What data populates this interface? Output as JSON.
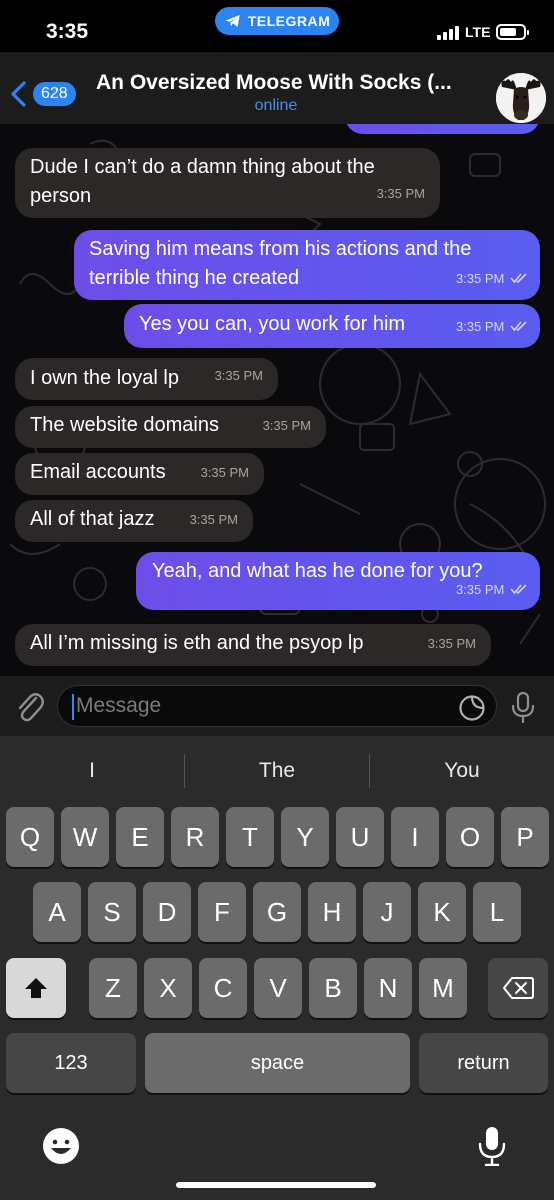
{
  "status_bar": {
    "time": "3:35",
    "app_pill": "TELEGRAM",
    "network": "LTE"
  },
  "header": {
    "back_count": "628",
    "title": "An Oversized Moose With Socks (...",
    "status": "online"
  },
  "messages": [
    {
      "dir": "in",
      "text": "Dude I can’t do a damn thing about the person",
      "time": "3:35 PM"
    },
    {
      "dir": "out",
      "text": "Saving him means from his actions and the terrible thing he created",
      "time": "3:35 PM"
    },
    {
      "dir": "out",
      "text": "Yes you can, you work for him",
      "time": "3:35 PM"
    },
    {
      "dir": "in",
      "text": "I own the loyal lp",
      "time": "3:35 PM"
    },
    {
      "dir": "in",
      "text": "The website domains",
      "time": "3:35 PM"
    },
    {
      "dir": "in",
      "text": "Email accounts",
      "time": "3:35 PM"
    },
    {
      "dir": "in",
      "text": "All of that jazz",
      "time": "3:35 PM"
    },
    {
      "dir": "out",
      "text": "Yeah, and what has he done for you?",
      "time": "3:35 PM"
    },
    {
      "dir": "in",
      "text": "All I’m missing is eth and the psyop lp",
      "time": "3:35 PM"
    }
  ],
  "input": {
    "placeholder": "Message"
  },
  "keyboard": {
    "suggestions": [
      "I",
      "The",
      "You"
    ],
    "row1": [
      "Q",
      "W",
      "E",
      "R",
      "T",
      "Y",
      "U",
      "I",
      "O",
      "P"
    ],
    "row2": [
      "A",
      "S",
      "D",
      "F",
      "G",
      "H",
      "J",
      "K",
      "L"
    ],
    "row3": [
      "Z",
      "X",
      "C",
      "V",
      "B",
      "N",
      "M"
    ],
    "numbers_label": "123",
    "space_label": "space",
    "return_label": "return"
  },
  "colors": {
    "accent": "#2c84f0",
    "outgoing_bubble": "#6d4de8",
    "incoming_bubble": "#2d2828",
    "header_bg": "#1c1c1d",
    "keyboard_bg": "#2b2b2b"
  }
}
